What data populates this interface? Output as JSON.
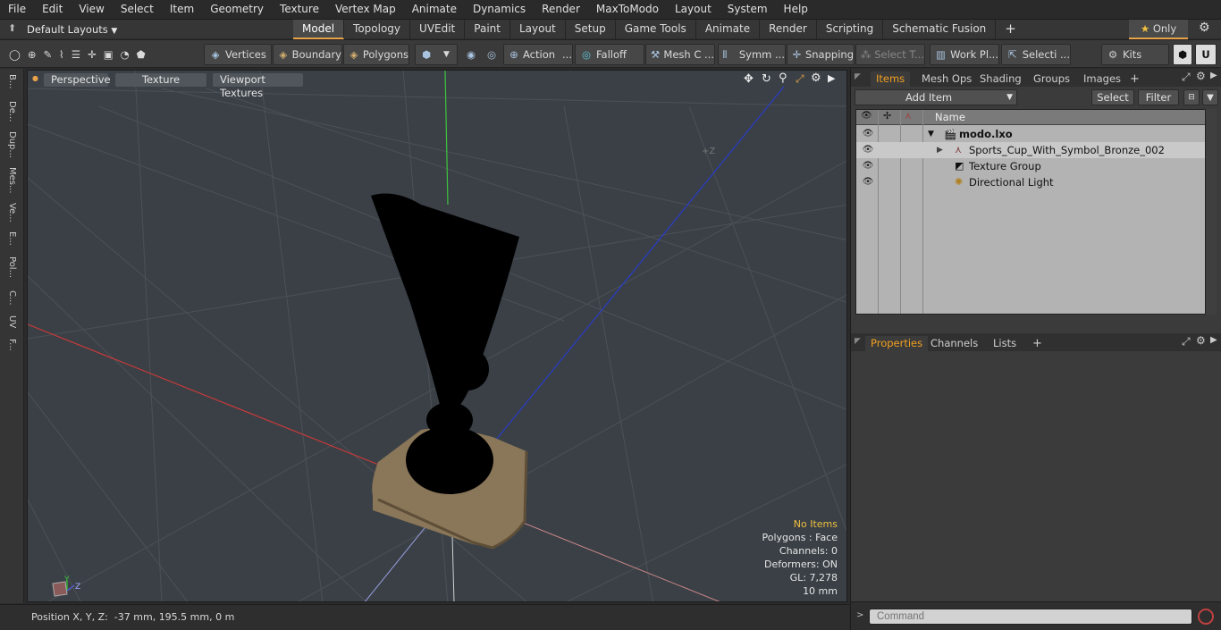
{
  "menu": [
    "File",
    "Edit",
    "View",
    "Select",
    "Item",
    "Geometry",
    "Texture",
    "Vertex Map",
    "Animate",
    "Dynamics",
    "Render",
    "MaxToModo",
    "Layout",
    "System",
    "Help"
  ],
  "layout_selector": "Default Layouts",
  "mode_tabs": [
    "Model",
    "Topology",
    "UVEdit",
    "Paint",
    "Layout",
    "Setup",
    "Game Tools",
    "Animate",
    "Render",
    "Scripting",
    "Schematic Fusion"
  ],
  "active_mode_tab": "Model",
  "only_label": "Only",
  "toolbar": {
    "vertices": "Vertices",
    "boundary": "Boundary",
    "polygons": "Polygons",
    "action": "Action",
    "falloff": "Falloff",
    "mesh": "Mesh C ...",
    "symm": "Symm ...",
    "snapping": "Snapping",
    "select_t": "Select T...",
    "work_plane": "Work Pl...",
    "selection": "Selecti ...",
    "kits": "Kits"
  },
  "left_tabs": [
    "B...",
    "De...",
    "Dup...",
    "Mes...",
    "Ve...",
    "E...",
    "Pol...",
    "C...",
    "UV",
    "F..."
  ],
  "viewport": {
    "perspective": "Perspective",
    "texture": "Texture",
    "viewport_textures": "Viewport Textures",
    "axis_label": "+Z",
    "info": {
      "items": "No Items",
      "polygons": "Polygons : Face",
      "channels": "Channels: 0",
      "deformers": "Deformers: ON",
      "gl": "GL: 7,278",
      "scale": "10 mm"
    }
  },
  "status_position": "Position X, Y, Z:  -37 mm, 195.5 mm, 0 m",
  "items_panel": {
    "tabs": [
      "Items",
      "Mesh Ops",
      "Shading",
      "Groups",
      "Images"
    ],
    "active_tab": "Items",
    "add_item": "Add Item",
    "select": "Select",
    "filter": "Filter",
    "column_name": "Name",
    "rows": [
      {
        "label": "modo.lxo"
      },
      {
        "label": "Sports_Cup_With_Symbol_Bronze_002"
      },
      {
        "label": "Texture Group"
      },
      {
        "label": "Directional Light"
      }
    ]
  },
  "properties_panel": {
    "tabs": [
      "Properties",
      "Channels",
      "Lists"
    ],
    "active_tab": "Properties"
  },
  "command_placeholder": "Command",
  "colors": {
    "accent": "#f0a020",
    "active_tab_underline": "#e8a24a"
  }
}
